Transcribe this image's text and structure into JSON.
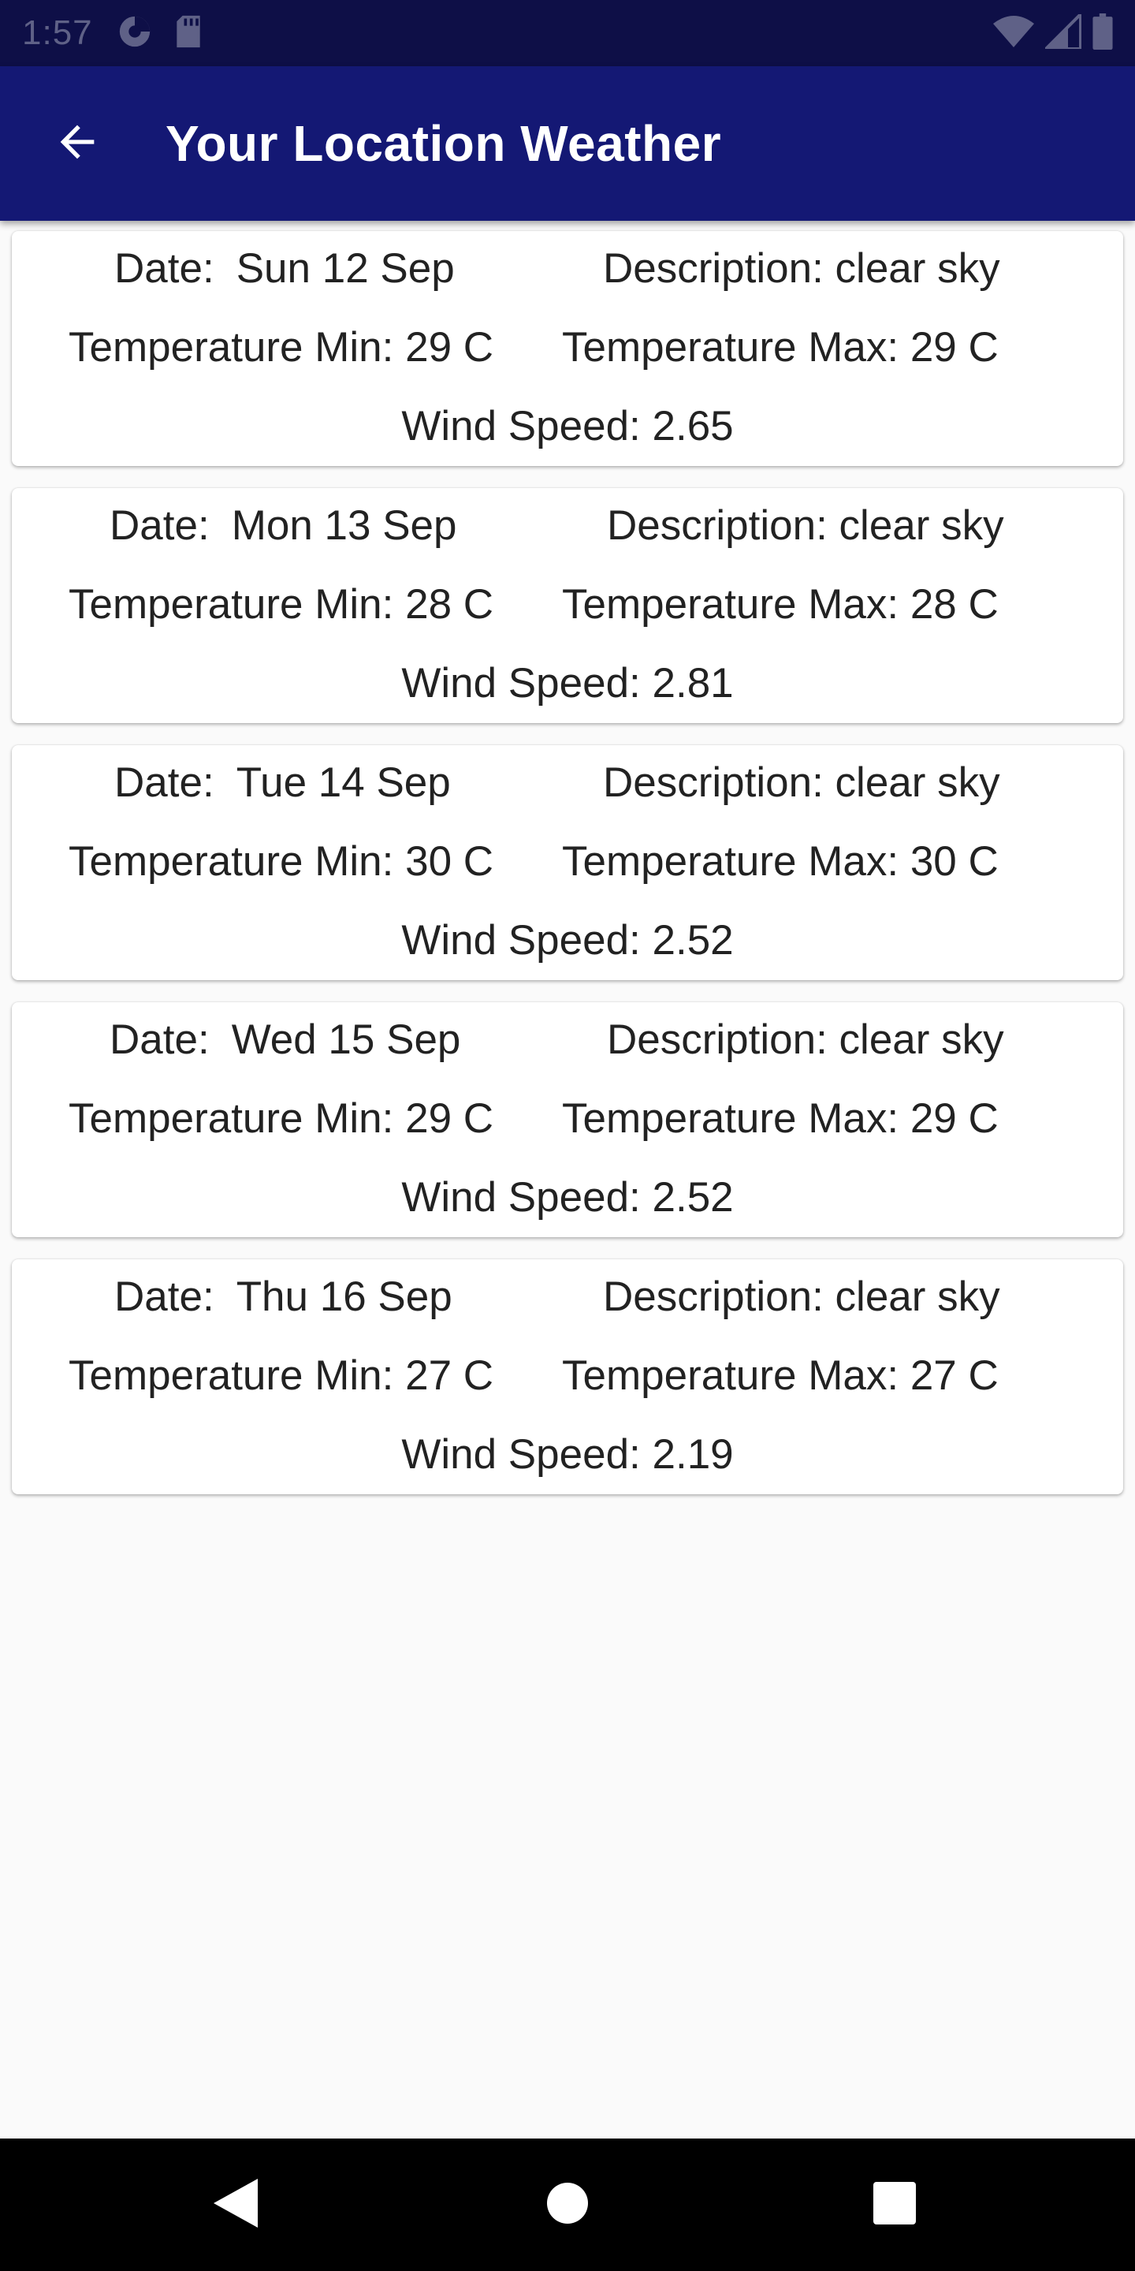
{
  "status_bar": {
    "time": "1:57",
    "icons": [
      "pie-chart-icon",
      "sd-card-icon",
      "wifi-icon",
      "cell-signal-icon",
      "battery-icon"
    ],
    "background": "#0e0f47"
  },
  "app_bar": {
    "title": "Your Location Weather",
    "back_icon": "arrow-back-icon",
    "background": "#141874"
  },
  "forecasts": [
    {
      "date_label": "Date:",
      "date": "Sun 12 Sep",
      "description": "Description: clear sky",
      "temp_min": "Temperature Min: 29 C",
      "temp_max": "Temperature Max: 29 C",
      "wind": "Wind Speed: 2.65"
    },
    {
      "date_label": "Date:",
      "date": "Mon 13 Sep",
      "description": "Description: clear sky",
      "temp_min": "Temperature Min: 28 C",
      "temp_max": "Temperature Max: 28 C",
      "wind": "Wind Speed: 2.81"
    },
    {
      "date_label": "Date:",
      "date": "Tue 14 Sep",
      "description": "Description: clear sky",
      "temp_min": "Temperature Min: 30 C",
      "temp_max": "Temperature Max: 30 C",
      "wind": "Wind Speed: 2.52"
    },
    {
      "date_label": "Date:",
      "date": "Wed 15 Sep",
      "description": "Description: clear sky",
      "temp_min": "Temperature Min: 29 C",
      "temp_max": "Temperature Max: 29 C",
      "wind": "Wind Speed: 2.52"
    },
    {
      "date_label": "Date:",
      "date": "Thu 16 Sep",
      "description": "Description: clear sky",
      "temp_min": "Temperature Min: 27 C",
      "temp_max": "Temperature Max: 27 C",
      "wind": "Wind Speed: 2.19"
    }
  ],
  "nav_bar": {
    "icons": [
      "nav-back-icon",
      "nav-home-icon",
      "nav-recents-icon"
    ]
  }
}
